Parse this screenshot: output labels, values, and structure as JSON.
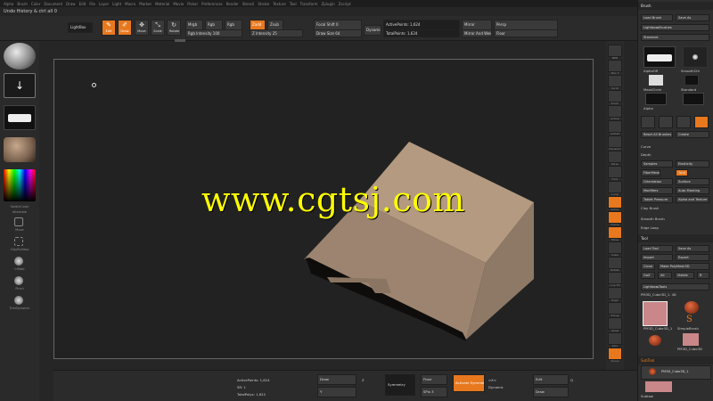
{
  "title_bar": {
    "text": "Undo History & ctrl all 0"
  },
  "menubar": {
    "items": [
      "Alpha",
      "Brush",
      "Color",
      "Document",
      "Draw",
      "Edit",
      "File",
      "Layer",
      "Light",
      "Macro",
      "Marker",
      "Material",
      "Movie",
      "Picker",
      "Preferences",
      "Render",
      "Stencil",
      "Stroke",
      "Texture",
      "Tool",
      "Transform",
      "Zplugin",
      "Zscript"
    ]
  },
  "toolbar": {
    "lightbox": "LightBox",
    "edit": "Edit",
    "draw": "Draw",
    "move": "Move",
    "scale": "Scale",
    "rotate": "Rotate",
    "rgb": "Rgb",
    "rgb_intensity": "Rgb Intensity 100",
    "mrgb": "Mrgb",
    "zadd": "Zadd",
    "zsub": "Zsub",
    "z_intensity": "Z Intensity 25",
    "focal_shift": "Focal Shift 0",
    "draw_size": "Draw Size 64",
    "dynamic": "Dynamic",
    "active_points": "ActivePoints: 1,624",
    "total_points": "TotalPoints: 1,624",
    "persp": "Persp",
    "floor": "Floor",
    "mirror_label": "Mirror",
    "mirror_weld": "Mirror And Weld",
    "rgb_chip": "Rgb"
  },
  "left_shelf": {
    "items": [
      "Standard",
      "DragRect",
      "Alpha Off",
      "Texture Off",
      "MatCap Gray",
      "Gradient"
    ],
    "sub_labels": [
      "SwitchColor",
      "Alternate",
      "Move",
      "ClayBuildup",
      "Inflate",
      "Pinch",
      "TrimDynamic",
      "hPolish"
    ]
  },
  "canvas": {
    "watermark": "www.cgtsj.com",
    "cube_colors": {
      "top": "#b39a80",
      "left": "#9c8470",
      "right": "#8e7866",
      "dark_face": "#0f0d0b"
    }
  },
  "right_shelf": {
    "labels": [
      "BPR",
      "SPix 3",
      "Scroll",
      "Zoom",
      "Actual",
      "AAHalf",
      "Dynamic",
      "Persp",
      "Floor",
      "Local",
      "Gizmo",
      "Frame",
      "Move",
      "Scale",
      "Rotate",
      "Line Fill",
      "PolyF",
      "Transp",
      "Ghost",
      "Solo",
      "Xpose"
    ]
  },
  "tray": {
    "header": "Brush",
    "load_brush": "Load Brush",
    "save_as": "Save As",
    "lightbox_brushes": "Lightbox▸Brushes",
    "brush_size_label": "Standard",
    "alpha_off": "AlphaOff",
    "smooth_ctrl": "SmoothCtrl",
    "mask_circle": "MaskCircle",
    "standard": "Standard",
    "alpha_label": "Alpha",
    "rows": [
      "Reset All Brushes",
      "Create",
      "Curve",
      "Depth",
      "Samples",
      "Elasticity",
      "FiberMesh",
      "Twist",
      "Orientation",
      "Surface",
      "Modifiers",
      "Auto Masking",
      "Tablet Pressure",
      "Alpha and Texture",
      "Clay Brush",
      "Smooth Brush",
      "Edge Loop"
    ],
    "subtool_header": "SubTool",
    "tool_header": "Tool",
    "tool_buttons": [
      "Load Tool",
      "Save As",
      "Import",
      "Export",
      "Clone",
      "Make PolyMesh3D",
      "GoZ",
      "All",
      "Visible",
      "R"
    ],
    "lightbox_tools": "Lightbox▸Tools",
    "polymesh_label": "PM3D_Cube3D_1. 48",
    "cube_label": "PM3D_Cube3D_1",
    "sphere_label": "SimpleBrush",
    "polymesh_label2": "PM3D_Cube3D",
    "subtool_item": "PM3D_Cube3D_1",
    "subtool_hint": "Subtool"
  },
  "bottombar": {
    "active_points": "ActivePoints: 1,624",
    "polys": "TotalPolys: 1,622",
    "draw_label": "Draw",
    "y_label": "Y",
    "z_label": "Z",
    "zoom_label": "Zoom",
    "zoom_value": "SR: 1",
    "symmetry": "Symmetry",
    "floor": "Floor",
    "spix": "SPix 3",
    "dynamic_label": "Dynamic",
    "active": "Activate Symmetry",
    "x_label": ">X<",
    "move": "Move",
    "q_label": "Q",
    "edit_label": "Edit",
    "draw_btn": "Draw"
  }
}
